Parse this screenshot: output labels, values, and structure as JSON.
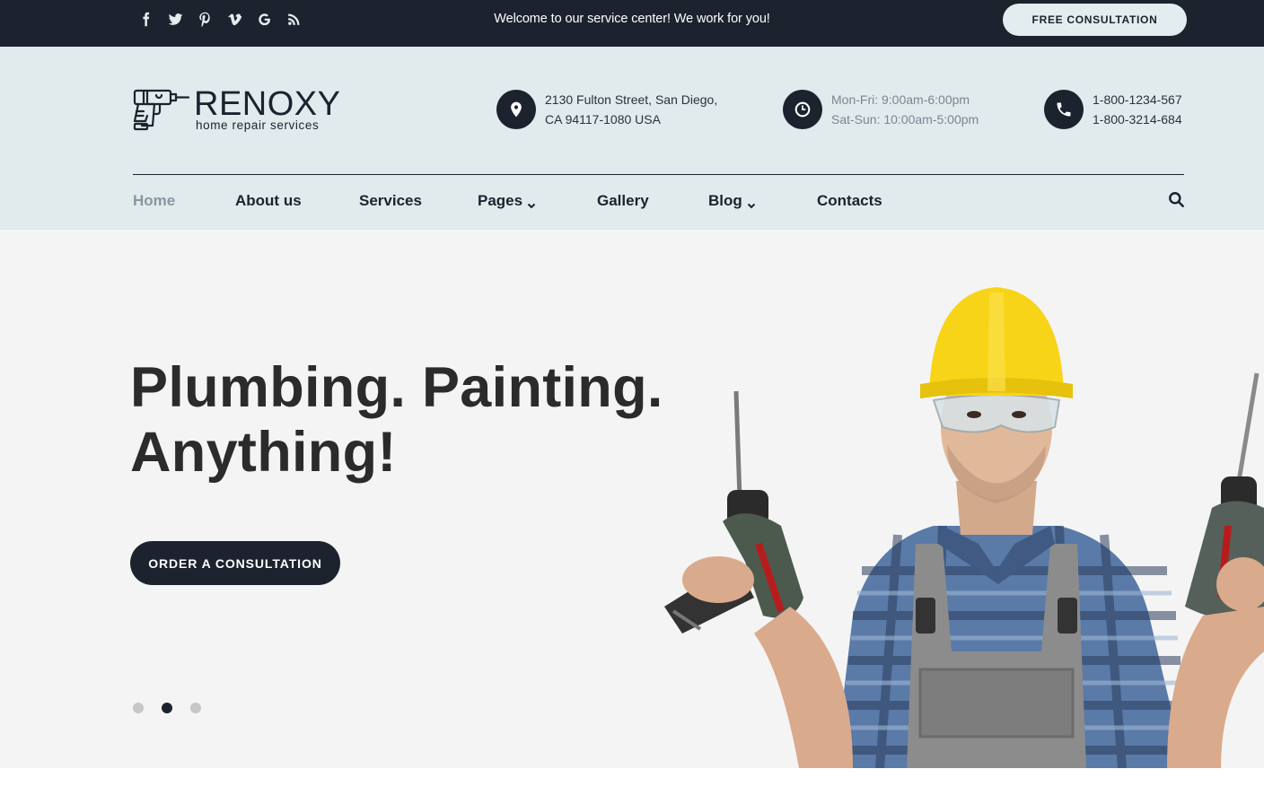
{
  "topbar": {
    "social": [
      {
        "icon": "facebook-icon"
      },
      {
        "icon": "twitter-icon"
      },
      {
        "icon": "pinterest-icon"
      },
      {
        "icon": "vimeo-icon"
      },
      {
        "icon": "google-icon"
      },
      {
        "icon": "rss-icon"
      }
    ],
    "welcome": "Welcome to our service center! We work for you!",
    "free_consultation": "FREE CONSULTATION"
  },
  "header": {
    "logo_name": "RENOXY",
    "logo_tagline": "home repair services",
    "address": {
      "line1": "2130 Fulton Street, San Diego,",
      "line2": "CA 94117-1080 USA"
    },
    "hours": {
      "line1": "Mon-Fri: 9:00am-6:00pm",
      "line2": "Sat-Sun: 10:00am-5:00pm"
    },
    "phones": {
      "line1": "1-800-1234-567",
      "line2": "1-800-3214-684"
    }
  },
  "nav": {
    "items": [
      {
        "label": "Home",
        "active": true
      },
      {
        "label": "About us"
      },
      {
        "label": "Services"
      },
      {
        "label": "Pages",
        "dropdown": true
      },
      {
        "label": "Gallery"
      },
      {
        "label": "Blog",
        "dropdown": true
      },
      {
        "label": "Contacts"
      }
    ]
  },
  "hero": {
    "title_line1": "Plumbing. Painting.",
    "title_line2": "Anything!",
    "cta": "ORDER A CONSULTATION",
    "slides": 3,
    "active_slide": 2
  },
  "colors": {
    "dark": "#1c222e",
    "header_bg": "#e1ebee",
    "hero_bg": "#f4f4f4",
    "helmet": "#f7d417"
  }
}
